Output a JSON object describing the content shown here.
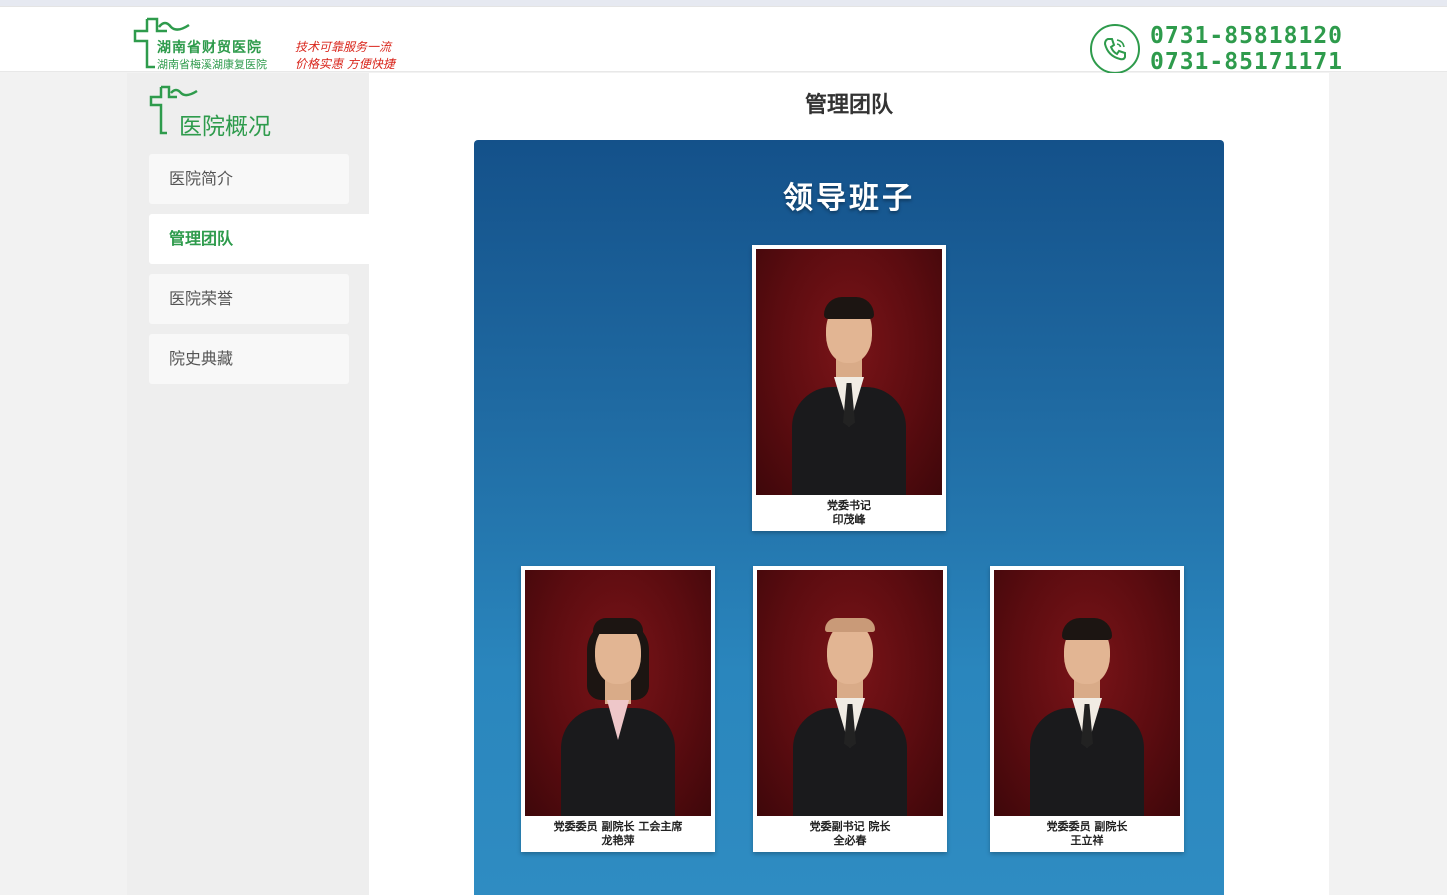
{
  "header": {
    "logo_name1": "湖南省财贸医院",
    "logo_name2": "湖南省梅溪湖康复医院",
    "slogan1": "技术可靠服务一流",
    "slogan2": "价格实惠 方便快捷",
    "phone1": "0731-85818120",
    "phone2": "0731-85171171"
  },
  "sidebar": {
    "title": "医院概况",
    "items": [
      {
        "label": "医院简介"
      },
      {
        "label": "管理团队"
      },
      {
        "label": "医院荣誉"
      },
      {
        "label": "院史典藏"
      }
    ],
    "active_index": 1
  },
  "main": {
    "page_title": "管理团队",
    "board_title": "领导班子",
    "members": [
      {
        "role": "党委书记",
        "name": "印茂峰"
      },
      {
        "role": "党委委员  副院长  工会主席",
        "name": "龙艳萍"
      },
      {
        "role": "党委副书记 院长",
        "name": "全必春"
      },
      {
        "role": "党委委员 副院长",
        "name": "王立祥"
      }
    ]
  },
  "colors": {
    "brand_green": "#2e9b4c",
    "slogan_red": "#d9261c",
    "board_top": "#14518a",
    "board_bottom": "#2f8cc2"
  }
}
